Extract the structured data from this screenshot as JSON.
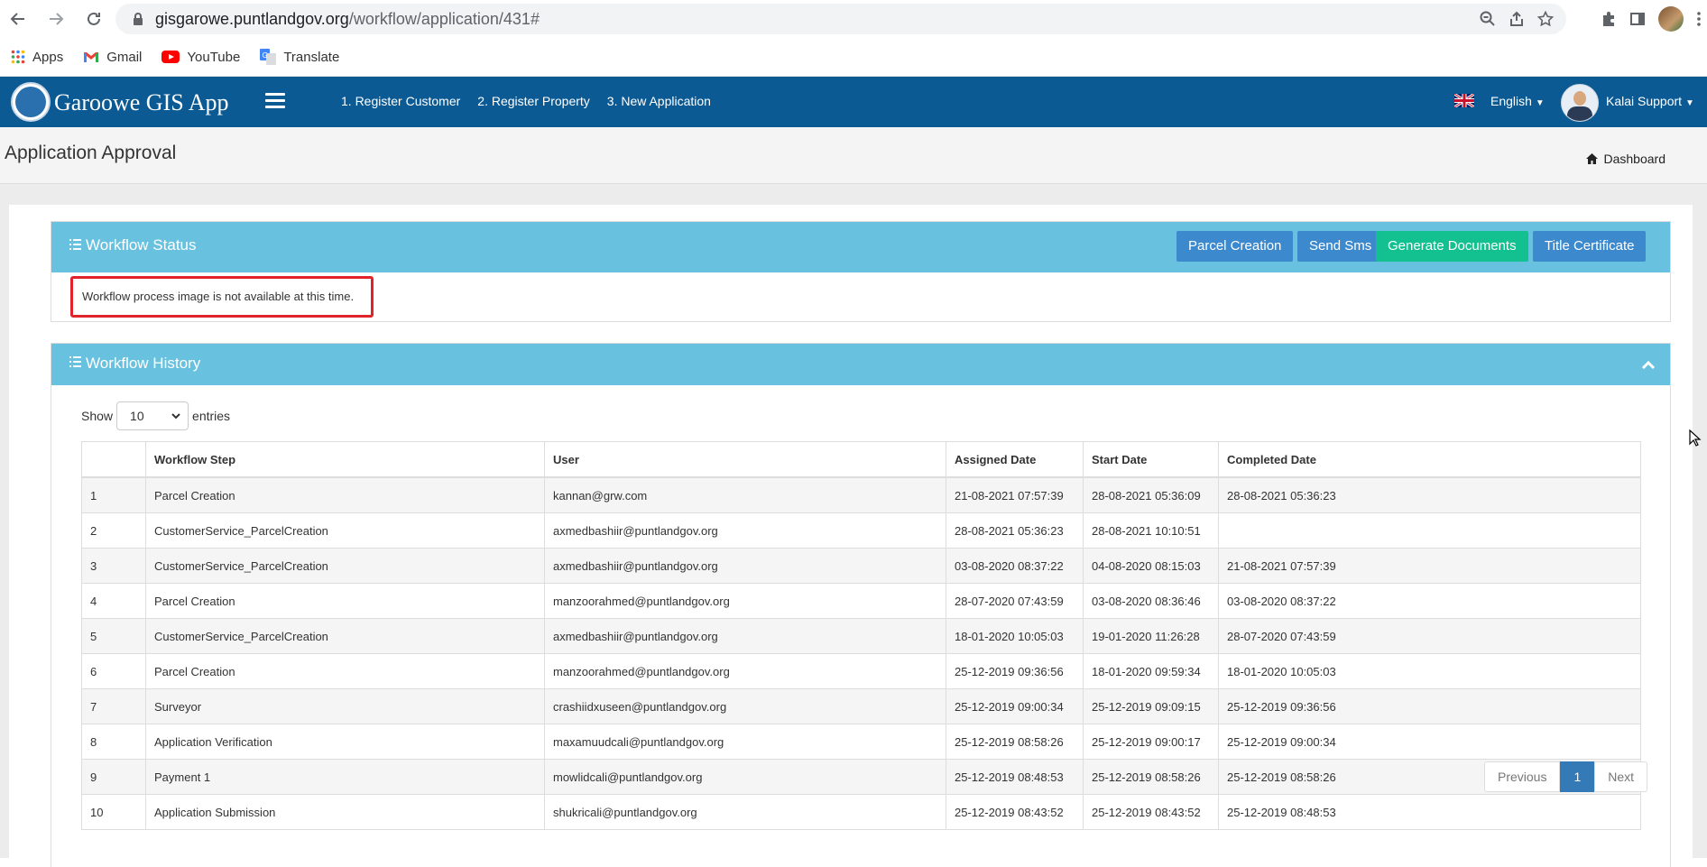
{
  "browser": {
    "url_domain": "gisgarowe.puntlandgov.org",
    "url_path": "/workflow/application/431#"
  },
  "bookmarks": [
    {
      "label": "Apps",
      "icon": "apps-grid-icon"
    },
    {
      "label": "Gmail",
      "icon": "gmail-icon"
    },
    {
      "label": "YouTube",
      "icon": "youtube-icon"
    },
    {
      "label": "Translate",
      "icon": "translate-icon"
    }
  ],
  "navbar": {
    "brand": "Garoowe GIS App",
    "links": [
      "1. Register Customer",
      "2. Register Property",
      "3. New Application"
    ],
    "language": "English",
    "user": "Kalai Support"
  },
  "page": {
    "title": "Application Approval",
    "breadcrumb": "Dashboard"
  },
  "workflow_status": {
    "title": "Workflow Status",
    "buttons": [
      "Parcel Creation",
      "Send Sms",
      "Generate Documents",
      "Title Certificate"
    ],
    "message": "Workflow process image is not available at this time."
  },
  "workflow_history": {
    "title": "Workflow History",
    "show_label": "Show",
    "entries_value": "10",
    "entries_label": "entries",
    "columns": [
      "",
      "Workflow Step",
      "User",
      "Assigned Date",
      "Start Date",
      "Completed Date"
    ],
    "rows": [
      [
        "1",
        "Parcel Creation",
        "kannan@grw.com",
        "21-08-2021 07:57:39",
        "28-08-2021 05:36:09",
        "28-08-2021 05:36:23"
      ],
      [
        "2",
        "CustomerService_ParcelCreation",
        "axmedbashiir@puntlandgov.org",
        "28-08-2021 05:36:23",
        "28-08-2021 10:10:51",
        ""
      ],
      [
        "3",
        "CustomerService_ParcelCreation",
        "axmedbashiir@puntlandgov.org",
        "03-08-2020 08:37:22",
        "04-08-2020 08:15:03",
        "21-08-2021 07:57:39"
      ],
      [
        "4",
        "Parcel Creation",
        "manzoorahmed@puntlandgov.org",
        "28-07-2020 07:43:59",
        "03-08-2020 08:36:46",
        "03-08-2020 08:37:22"
      ],
      [
        "5",
        "CustomerService_ParcelCreation",
        "axmedbashiir@puntlandgov.org",
        "18-01-2020 10:05:03",
        "19-01-2020 11:26:28",
        "28-07-2020 07:43:59"
      ],
      [
        "6",
        "Parcel Creation",
        "manzoorahmed@puntlandgov.org",
        "25-12-2019 09:36:56",
        "18-01-2020 09:59:34",
        "18-01-2020 10:05:03"
      ],
      [
        "7",
        "Surveyor",
        "crashiidxuseen@puntlandgov.org",
        "25-12-2019 09:00:34",
        "25-12-2019 09:09:15",
        "25-12-2019 09:36:56"
      ],
      [
        "8",
        "Application Verification",
        "maxamuudcali@puntlandgov.org",
        "25-12-2019 08:58:26",
        "25-12-2019 09:00:17",
        "25-12-2019 09:00:34"
      ],
      [
        "9",
        "Payment 1",
        "mowlidcali@puntlandgov.org",
        "25-12-2019 08:48:53",
        "25-12-2019 08:58:26",
        "25-12-2019 08:58:26"
      ],
      [
        "10",
        "Application Submission",
        "shukricali@puntlandgov.org",
        "25-12-2019 08:43:52",
        "25-12-2019 08:43:52",
        "25-12-2019 08:48:53"
      ]
    ],
    "pagination": {
      "previous": "Previous",
      "current": "1",
      "next": "Next"
    }
  },
  "colors": {
    "navbar": "#0b5a93",
    "panel_header": "#67c1df",
    "button_blue": "#3c89cd",
    "button_green": "#13c08f",
    "highlight_border": "#e0242c"
  }
}
